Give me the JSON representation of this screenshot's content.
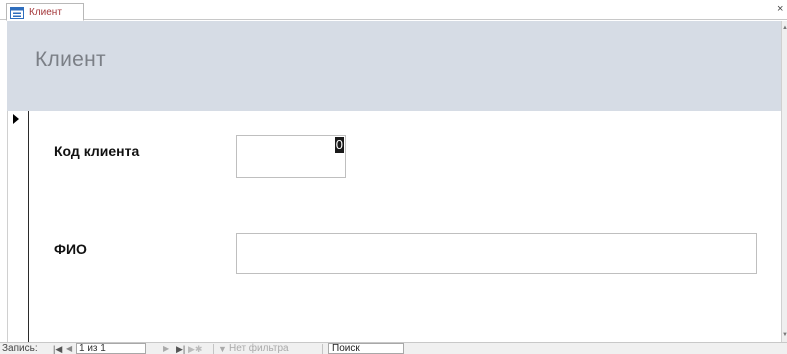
{
  "tab": {
    "label": "Клиент",
    "icon": "form-icon",
    "close_label": "×"
  },
  "form": {
    "title": "Клиент",
    "header_color": "#d6dce5",
    "fields": [
      {
        "label": "Код клиента",
        "value": "0"
      },
      {
        "label": "ФИО",
        "value": ""
      }
    ]
  },
  "navigation": {
    "record_label": "Запись:",
    "current": "1 из 1",
    "first_icon": "first-record-icon",
    "prev_icon": "previous-record-icon",
    "next_icon": "next-record-icon",
    "last_icon": "last-record-icon",
    "new_icon": "new-record-icon",
    "filter_icon": "filter-icon",
    "filter_label": "Нет фильтра",
    "search_placeholder": "Поиск"
  }
}
